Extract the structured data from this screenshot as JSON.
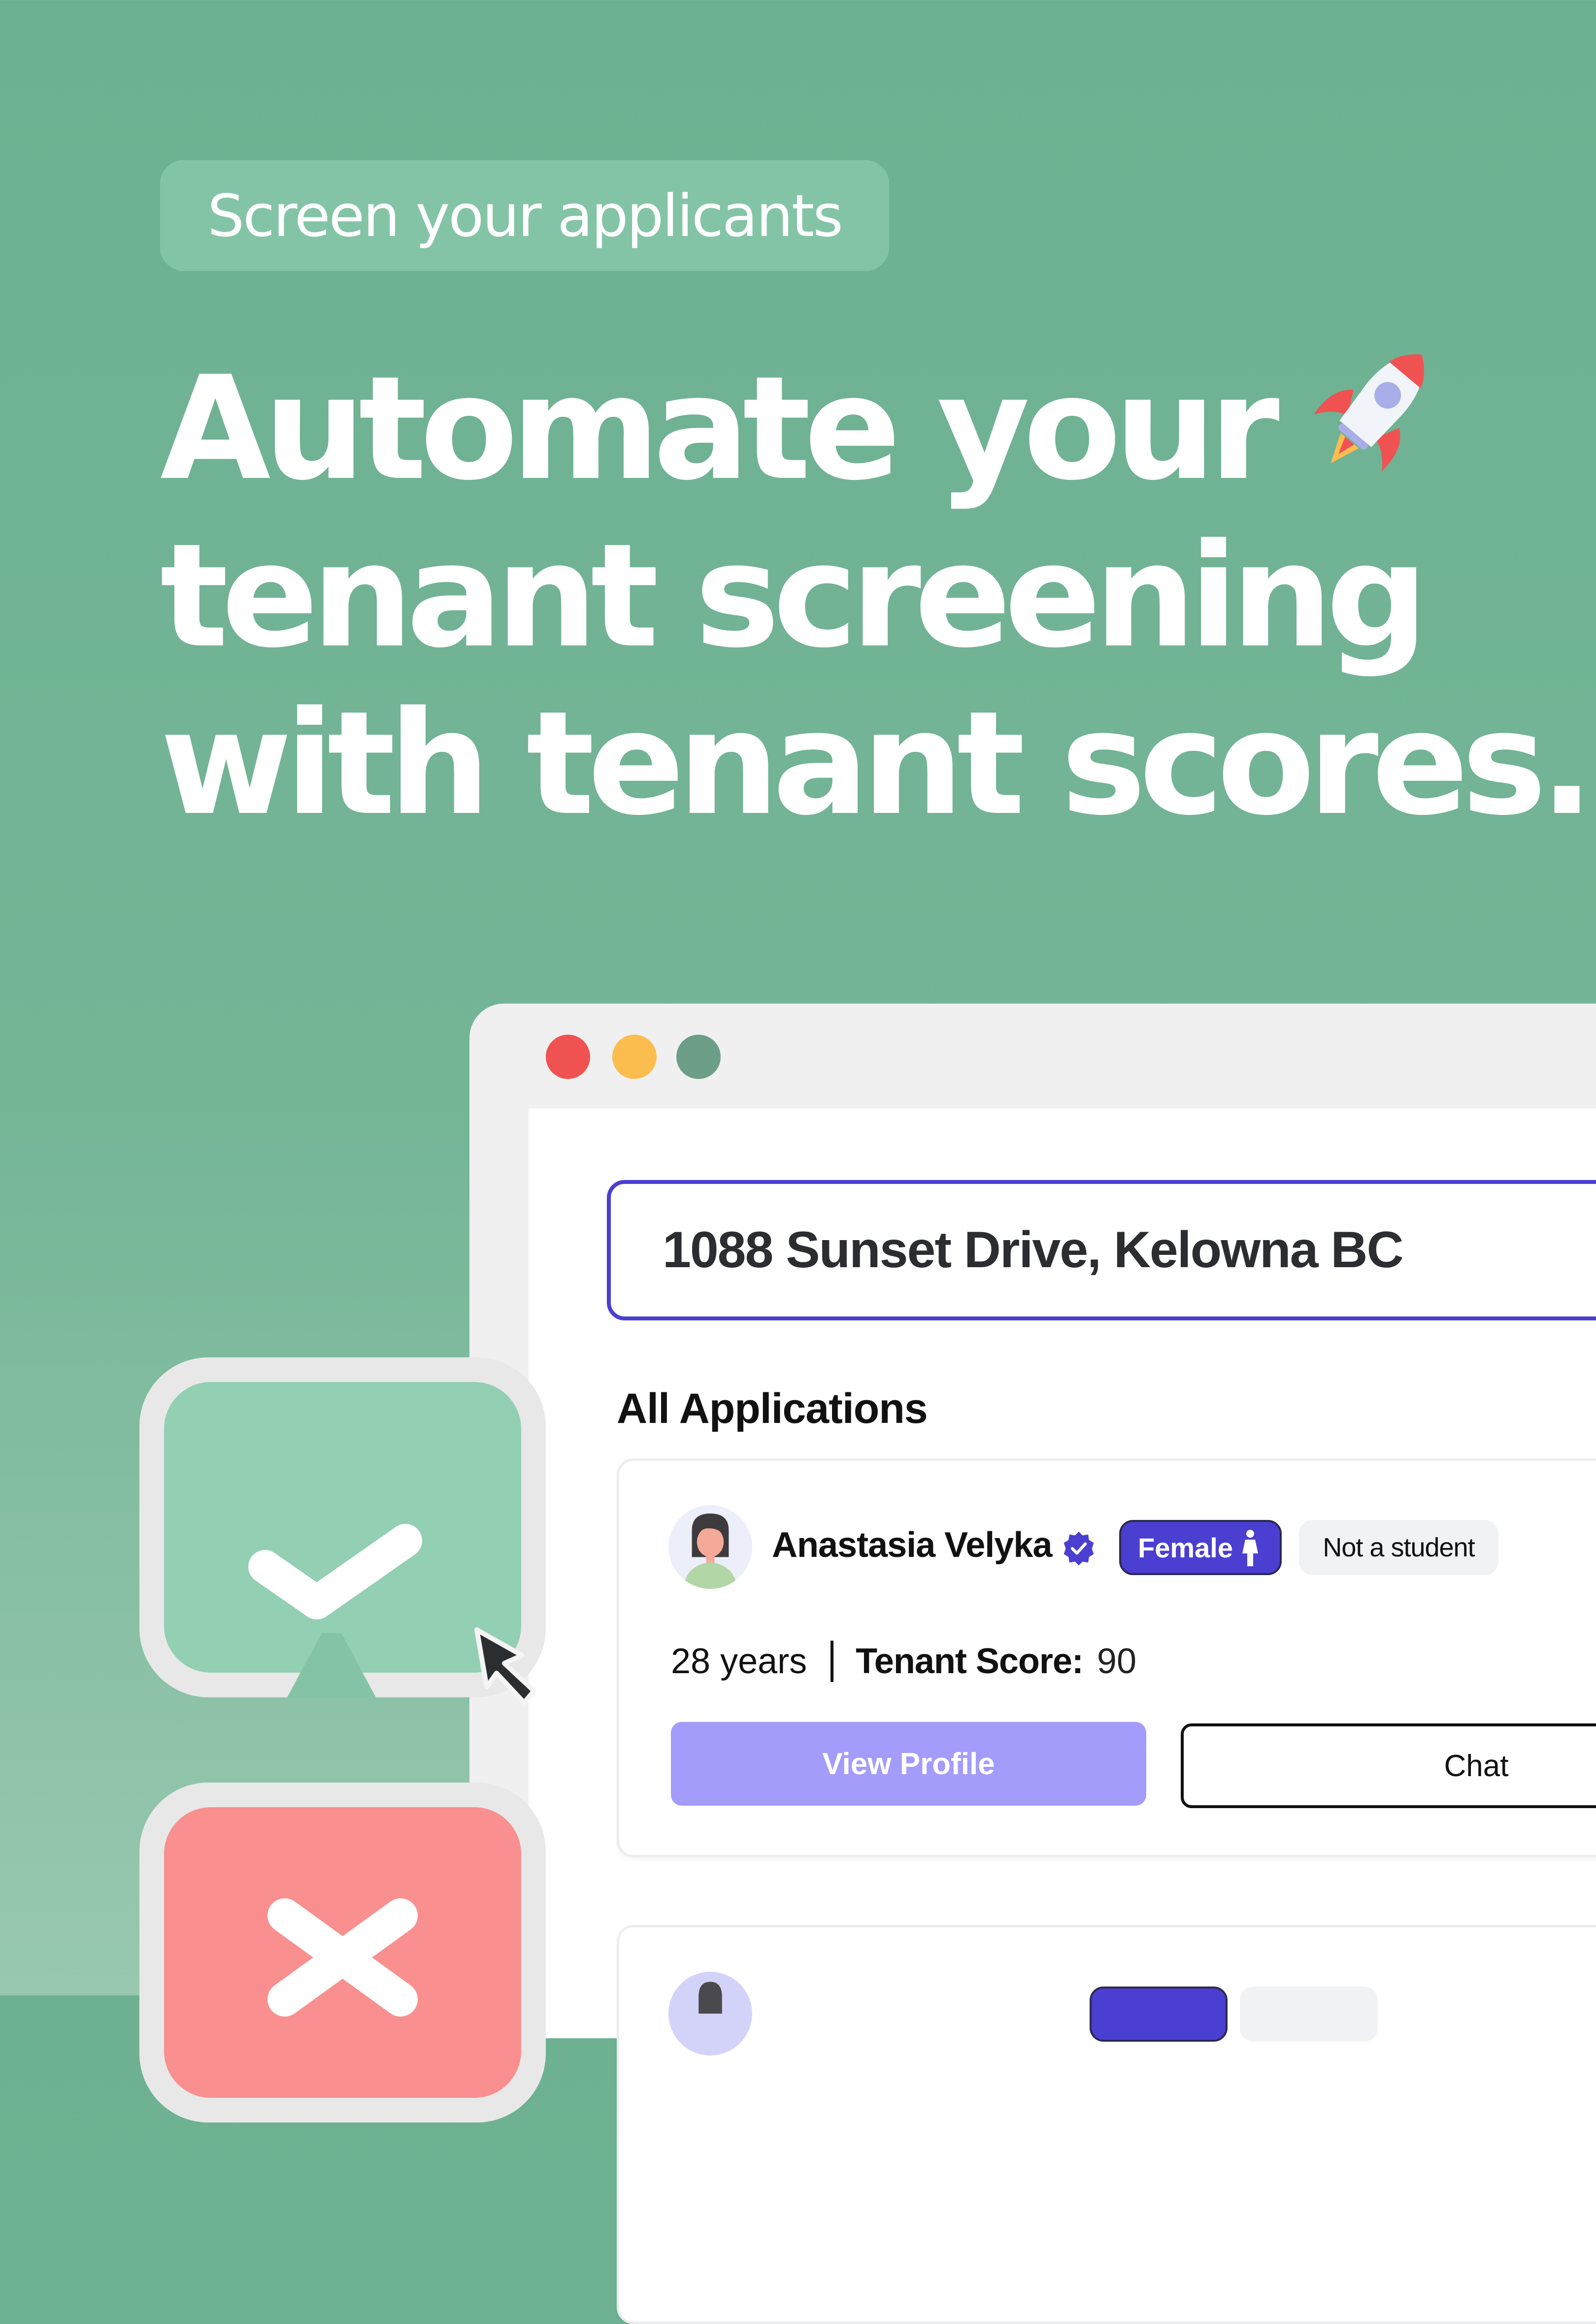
{
  "promo": {
    "tag_label": "Screen your applicants",
    "headline_lines": [
      "Automate your",
      "tenant screening",
      "with tenant scores."
    ],
    "headline_icon": "rocket-icon"
  },
  "window": {
    "controls": [
      "close",
      "minimize",
      "maximize"
    ],
    "address": "1088 Sunset Drive, Kelowna BC",
    "section_title": "All Applications",
    "applications": [
      {
        "name": "Anastasia Velyka",
        "verified": true,
        "gender_badge": "Female",
        "student_badge": "Not a student",
        "age": "28 years",
        "score_label": "Tenant Score:",
        "score": "90",
        "view_button": "View Profile",
        "chat_button": "Chat"
      }
    ]
  },
  "actions": {
    "approve_icon": "check-icon",
    "reject_icon": "x-icon"
  },
  "colors": {
    "background": "#6db192",
    "accent": "#4a3fd0",
    "view_button": "#a39cfb",
    "approve": "#93cfb3",
    "reject": "#f98f8f"
  }
}
